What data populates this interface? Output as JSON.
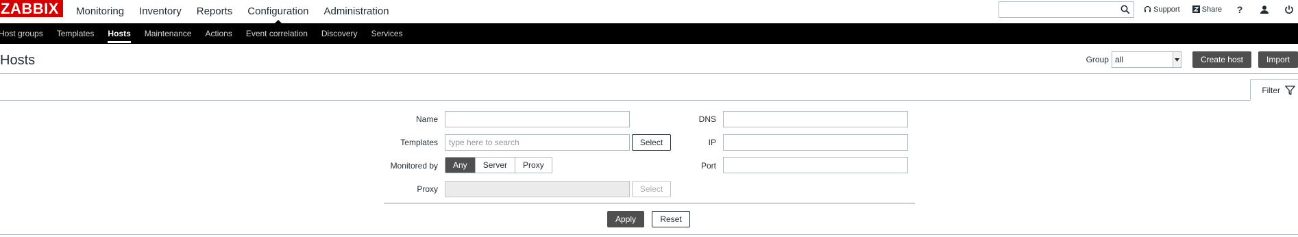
{
  "header": {
    "logo": "ZABBIX",
    "nav": [
      {
        "label": "Monitoring",
        "active": false
      },
      {
        "label": "Inventory",
        "active": false
      },
      {
        "label": "Reports",
        "active": false
      },
      {
        "label": "Configuration",
        "active": true
      },
      {
        "label": "Administration",
        "active": false
      }
    ],
    "search": {
      "value": "",
      "placeholder": ""
    },
    "support_label": "Support",
    "share_label": "Share",
    "help_label": "?"
  },
  "subnav": [
    {
      "label": "Host groups",
      "active": false
    },
    {
      "label": "Templates",
      "active": false
    },
    {
      "label": "Hosts",
      "active": true
    },
    {
      "label": "Maintenance",
      "active": false
    },
    {
      "label": "Actions",
      "active": false
    },
    {
      "label": "Event correlation",
      "active": false
    },
    {
      "label": "Discovery",
      "active": false
    },
    {
      "label": "Services",
      "active": false
    }
  ],
  "page": {
    "title": "Hosts",
    "group_label": "Group",
    "group_value": "all",
    "create_host_label": "Create host",
    "import_label": "Import"
  },
  "filter": {
    "tab_label": "Filter",
    "name": {
      "label": "Name",
      "value": ""
    },
    "templates": {
      "label": "Templates",
      "placeholder": "type here to search",
      "select_label": "Select"
    },
    "monitored_by": {
      "label": "Monitored by",
      "options": [
        "Any",
        "Server",
        "Proxy"
      ],
      "selected": "Any"
    },
    "proxy": {
      "label": "Proxy",
      "value": "",
      "select_label": "Select"
    },
    "dns": {
      "label": "DNS",
      "value": ""
    },
    "ip": {
      "label": "IP",
      "value": ""
    },
    "port": {
      "label": "Port",
      "value": ""
    },
    "apply_label": "Apply",
    "reset_label": "Reset"
  },
  "colors": {
    "brand_red": "#d40000",
    "subnav_bg": "#000000",
    "dark_button": "#4f4f4f",
    "border": "#acbbc2"
  }
}
